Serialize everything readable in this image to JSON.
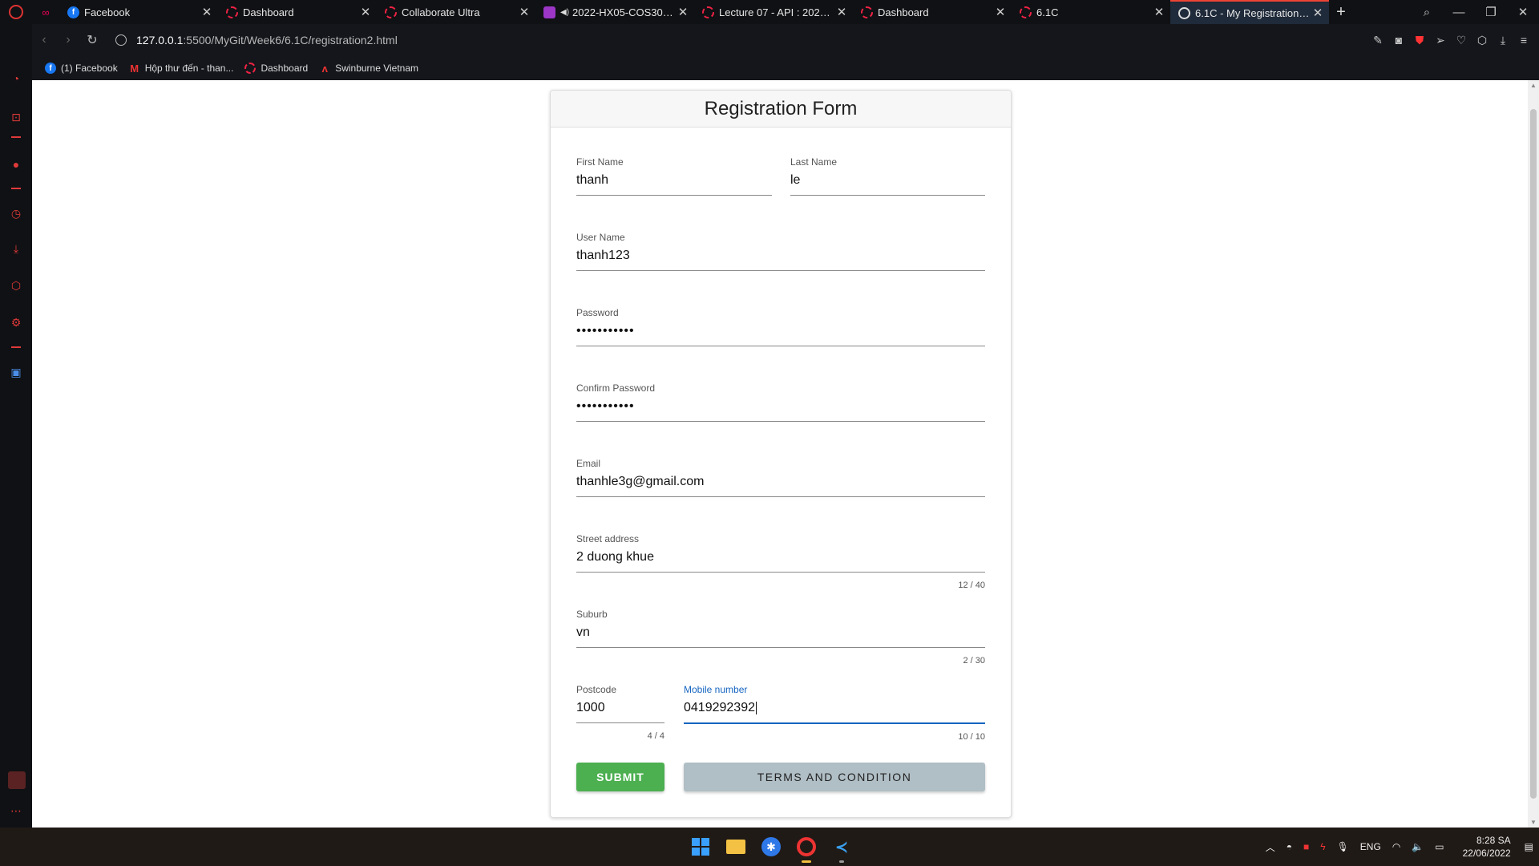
{
  "browser": {
    "tabs": [
      {
        "title": "Facebook",
        "favicon": "facebook"
      },
      {
        "title": "Dashboard",
        "favicon": "ring"
      },
      {
        "title": "Collaborate Ultra",
        "favicon": "ring"
      },
      {
        "title": "2022-HX05-COS30043-",
        "favicon": "purple"
      },
      {
        "title": "Lecture 07 - API : 2022-HX0",
        "favicon": "ring"
      },
      {
        "title": "Dashboard",
        "favicon": "ring"
      },
      {
        "title": "6.1C",
        "favicon": "ring"
      },
      {
        "title": "6.1C - My Registration Form",
        "favicon": "globe",
        "active": true
      }
    ],
    "url_host": "127.0.0.1",
    "url_path": ":5500/MyGit/Week6/6.1C/registration2.html",
    "bookmarks": [
      {
        "label": "(1) Facebook",
        "icon": "facebook"
      },
      {
        "label": "Hộp thư đến - than...",
        "icon": "gmail"
      },
      {
        "label": "Dashboard",
        "icon": "ring"
      },
      {
        "label": "Swinburne Vietnam",
        "icon": "swinburne"
      }
    ]
  },
  "form": {
    "title": "Registration Form",
    "first_name": {
      "label": "First Name",
      "value": "thanh"
    },
    "last_name": {
      "label": "Last Name",
      "value": "le"
    },
    "user_name": {
      "label": "User Name",
      "value": "thanh123"
    },
    "password": {
      "label": "Password",
      "value": "•••••••••••"
    },
    "confirm_password": {
      "label": "Confirm Password",
      "value": "•••••••••••"
    },
    "email": {
      "label": "Email",
      "value": "thanhle3g@gmail.com"
    },
    "street": {
      "label": "Street address",
      "value": "2 duong khue",
      "counter": "12 / 40"
    },
    "suburb": {
      "label": "Suburb",
      "value": "vn",
      "counter": "2 / 30"
    },
    "postcode": {
      "label": "Postcode",
      "value": "1000",
      "counter": "4 / 4"
    },
    "mobile": {
      "label": "Mobile number",
      "value": "0419292392",
      "counter": "10 / 10"
    },
    "submit_label": "SUBMIT",
    "terms_label": "TERMS AND CONDITION",
    "colors": {
      "submit": "#4caf50",
      "terms": "#b0bec5",
      "focus": "#1565c0"
    }
  },
  "taskbar": {
    "language": "ENG",
    "time": "8:28 SA",
    "date": "22/06/2022"
  }
}
